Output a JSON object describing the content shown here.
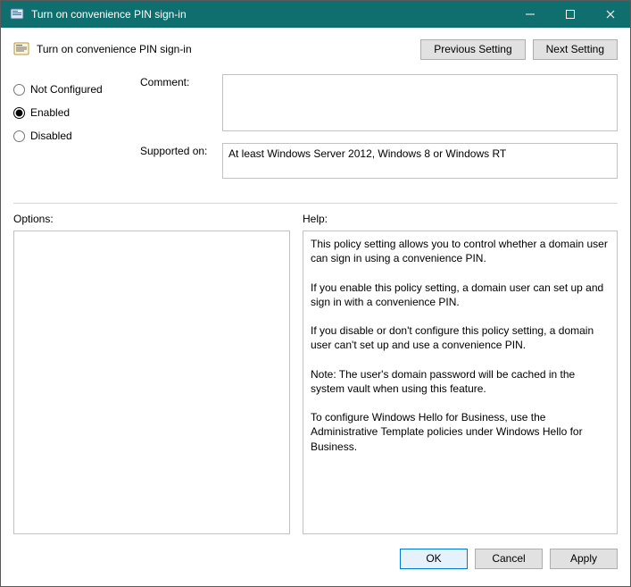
{
  "window": {
    "title": "Turn on convenience PIN sign-in"
  },
  "header": {
    "policy_name": "Turn on convenience PIN sign-in",
    "previous_label": "Previous Setting",
    "next_label": "Next Setting"
  },
  "state": {
    "not_configured_label": "Not Configured",
    "enabled_label": "Enabled",
    "disabled_label": "Disabled",
    "selected": "enabled"
  },
  "fields": {
    "comment_label": "Comment:",
    "comment_value": "",
    "supported_label": "Supported on:",
    "supported_value": "At least Windows Server 2012, Windows 8 or Windows RT"
  },
  "lower": {
    "options_label": "Options:",
    "help_label": "Help:",
    "options_content": "",
    "help_content": "This policy setting allows you to control whether a domain user can sign in using a convenience PIN.\n\nIf you enable this policy setting, a domain user can set up and sign in with a convenience PIN.\n\nIf you disable or don't configure this policy setting, a domain user can't set up and use a convenience PIN.\n\nNote: The user's domain password will be cached in the system vault when using this feature.\n\nTo configure Windows Hello for Business, use the Administrative Template policies under Windows Hello for Business."
  },
  "footer": {
    "ok_label": "OK",
    "cancel_label": "Cancel",
    "apply_label": "Apply"
  }
}
